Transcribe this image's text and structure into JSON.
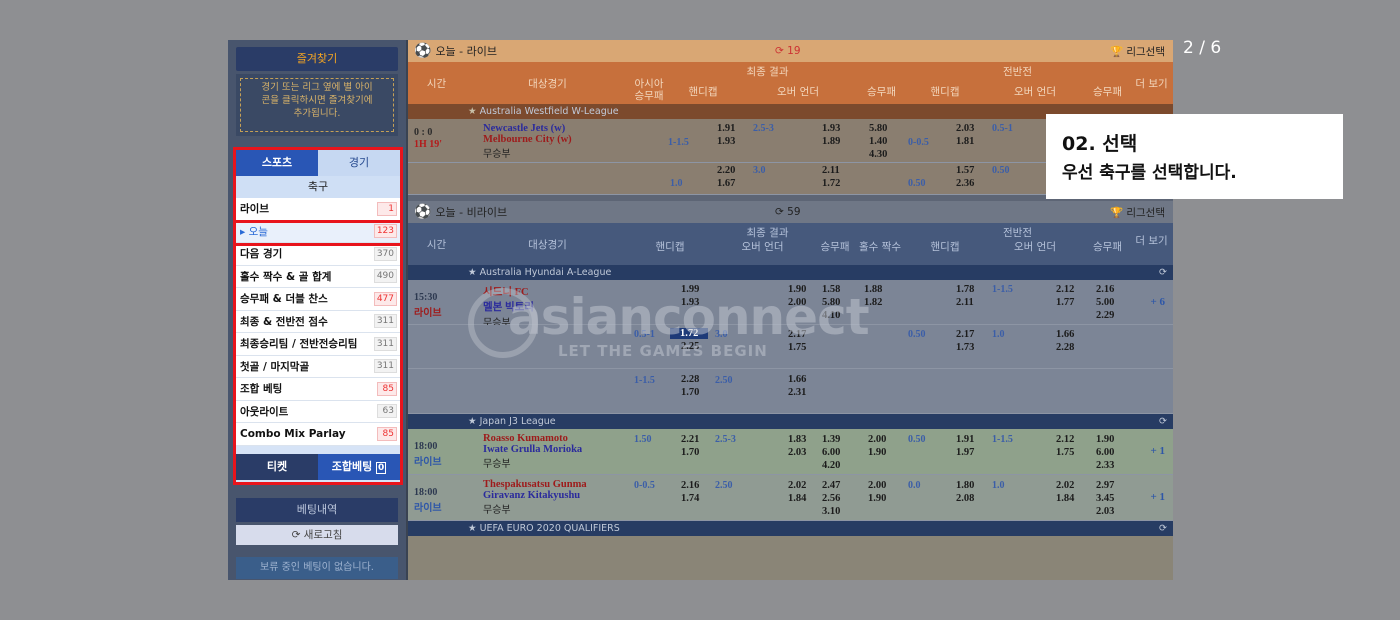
{
  "counter": "2 / 6",
  "tooltip": {
    "title": "02. 선택",
    "body": "우선 축구를 선택합니다."
  },
  "sidebar": {
    "favorites_title": "즐겨찾기",
    "favorites_note_1": "경기 또는 리그 옆에 별 아이",
    "favorites_note_2": "콘을 클릭하시면 즐겨찾기에",
    "favorites_note_3": "추가됩니다.",
    "tab_sports": "스포츠",
    "tab_games": "경기",
    "category": "축구",
    "items": [
      {
        "label": "라이브",
        "count": "1",
        "hot": true
      },
      {
        "label": "▸ 오늘",
        "count": "123",
        "hot": true
      },
      {
        "label": "다음 경기",
        "count": "370",
        "hot": false
      },
      {
        "label": "홀수 짝수 & 골 합계",
        "count": "490",
        "hot": false
      },
      {
        "label": "승무패 & 더블 찬스",
        "count": "477",
        "hot": true
      },
      {
        "label": "최종 & 전반전 점수",
        "count": "311",
        "hot": false
      },
      {
        "label": "최종승리팀 / 전반전승리팀",
        "count": "311",
        "hot": false
      },
      {
        "label": "첫골 / 마지막골",
        "count": "311",
        "hot": false
      },
      {
        "label": "조합 베팅",
        "count": "85",
        "hot": true
      },
      {
        "label": "아웃라이트",
        "count": "63",
        "hot": false
      },
      {
        "label": "Combo Mix Parlay",
        "count": "85",
        "hot": true
      }
    ],
    "ticket_tab": "티켓",
    "combo_tab": "조합베팅",
    "combo_count": "0",
    "history_title": "베팅내역",
    "refresh_label": "새로고침",
    "no_bets": "보류 중인 베팅이 없습니다."
  },
  "live_section": {
    "title": "오늘 - 라이브",
    "count": "19",
    "league_select": "리그선택",
    "header": {
      "time": "시간",
      "match": "대상경기",
      "final": "최종 결과",
      "half": "전반전",
      "asia": "아시아",
      "asia2": "승무패",
      "handicap": "핸디캡",
      "overunder": "오버 언더",
      "win": "승무패",
      "more": "더 보기"
    },
    "league": "Australia Westfield W-League",
    "match": {
      "score": "0 : 0",
      "time": "1H 19'",
      "home": "Newcastle Jets (w)",
      "away": "Melbourne City (w)",
      "draw": "무승부"
    }
  },
  "prelive_section": {
    "title": "오늘 - 비라이브",
    "count": "59",
    "league_select": "리그선택",
    "header": {
      "time": "시간",
      "match": "대상경기",
      "final": "최종 결과",
      "half": "전반전",
      "handicap": "핸디캡",
      "overunder": "오버 언더",
      "win": "승무패",
      "oddeven": "홀수 짝수",
      "more": "더 보기"
    },
    "leagues": [
      {
        "name": "Australia Hyundai A-League"
      },
      {
        "name": "Japan J3 League"
      },
      {
        "name": "UEFA EURO 2020 QUALIFIERS"
      }
    ],
    "matches": [
      {
        "time": "15:30",
        "status": "라이브",
        "home": "시드니 FC",
        "away": "멜본 빅토리",
        "draw": "무승부",
        "more": "+ 6"
      },
      {
        "time": "18:00",
        "status": "라이브",
        "home": "Roasso Kumamoto",
        "away": "Iwate Grulla Morioka",
        "draw": "무승부",
        "more": "+ 1"
      },
      {
        "time": "18:00",
        "status": "라이브",
        "home": "Thespakusatsu Gunma",
        "away": "Giravanz Kitakyushu",
        "draw": "무승부",
        "more": "+ 1"
      }
    ]
  },
  "watermark": {
    "brand": "asianconnect",
    "slogan": "LET THE GAMES BEGIN"
  }
}
